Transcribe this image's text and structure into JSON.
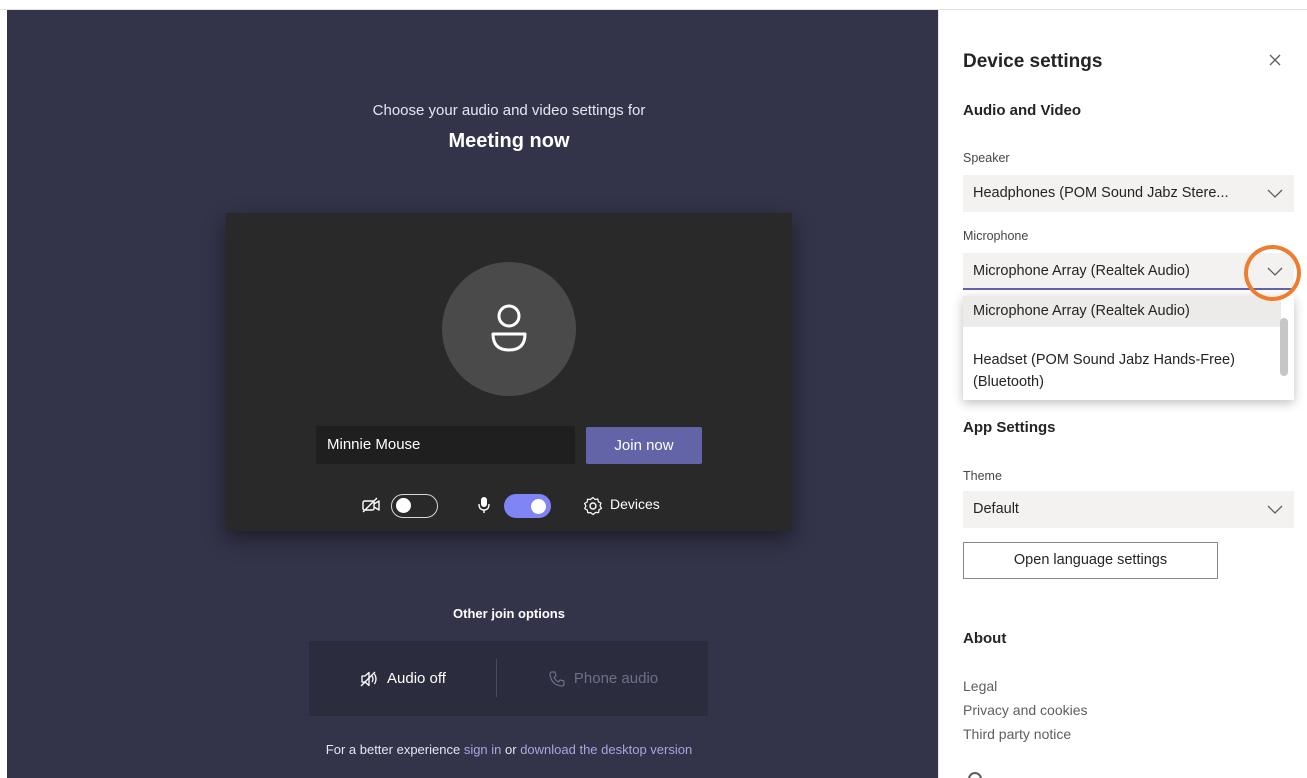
{
  "prejoin": {
    "subtitle": "Choose your audio and video settings for",
    "meeting_title": "Meeting now",
    "name_value": "Minnie Mouse",
    "join_label": "Join now",
    "video_toggle": "off",
    "mic_toggle": "on",
    "devices_label": "Devices",
    "other_options_title": "Other join options",
    "audio_off_label": "Audio off",
    "phone_audio_label": "Phone audio",
    "footer": {
      "prefix": "For a better experience ",
      "sign_in": "sign in",
      "or": " or ",
      "download": "download the desktop version"
    },
    "accent_color": "#6264a7"
  },
  "device_settings": {
    "title": "Device settings",
    "close_icon": "close-icon",
    "audio_video_heading": "Audio and Video",
    "speaker_label": "Speaker",
    "speaker_value": "Headphones (POM Sound Jabz Stere...",
    "microphone_label": "Microphone",
    "microphone_value": "Microphone Array (Realtek Audio)",
    "microphone_options": [
      "Microphone Array (Realtek Audio)",
      "Headset (POM Sound Jabz Hands-Free)",
      "(Bluetooth)"
    ],
    "app_settings_heading": "App Settings",
    "theme_label": "Theme",
    "theme_value": "Default",
    "language_button": "Open language settings",
    "about_heading": "About",
    "about_links": [
      "Legal",
      "Privacy and cookies",
      "Third party notice"
    ],
    "highlight_color": "#ee7d30"
  }
}
